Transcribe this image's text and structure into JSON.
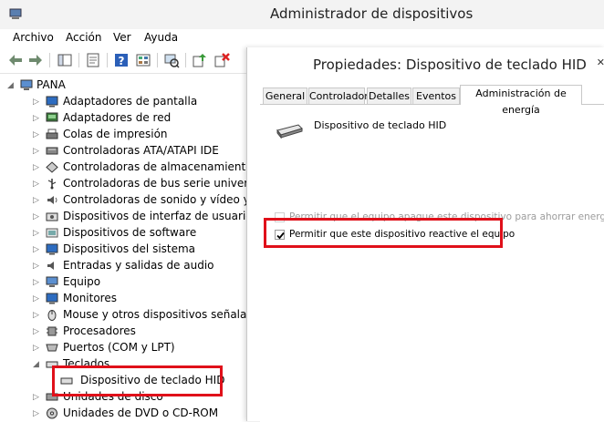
{
  "window": {
    "title": "Administrador de dispositivos"
  },
  "menu": [
    "Archivo",
    "Acción",
    "Ver",
    "Ayuda"
  ],
  "toolbar": {
    "buttons": [
      "back-arrow-icon",
      "forward-arrow-icon",
      "show-hide-tree-icon",
      "properties-icon",
      "help-icon",
      "view-icon",
      "scan-hardware-icon",
      "update-driver-icon",
      "uninstall-device-icon"
    ]
  },
  "tree": {
    "root": "PANA",
    "items": [
      "Adaptadores de pantalla",
      "Adaptadores de red",
      "Colas de impresión",
      "Controladoras ATA/ATAPI IDE",
      "Controladoras de almacenamiento",
      "Controladoras de bus serie universal",
      "Controladoras de sonido y vídeo y disp",
      "Dispositivos de interfaz de usuario (HID",
      "Dispositivos de software",
      "Dispositivos del sistema",
      "Entradas y salidas de audio",
      "Equipo",
      "Monitores",
      "Mouse y otros dispositivos señaladores",
      "Procesadores",
      "Puertos (COM y LPT)",
      "Teclados",
      "Dispositivo de teclado HID",
      "Unidades de disco",
      "Unidades de DVD o CD-ROM"
    ]
  },
  "dialog": {
    "title": "Propiedades: Dispositivo de teclado HID",
    "close": "✕",
    "tabs": [
      "General",
      "Controlador",
      "Detalles",
      "Eventos",
      "Administración de energía"
    ],
    "active_tab": 4,
    "device_name": "Dispositivo de teclado HID",
    "options": [
      {
        "label": "Permitir que el equipo apague este dispositivo para ahorrar energía",
        "checked": false,
        "enabled": false
      },
      {
        "label": "Permitir que este dispositivo reactive el equipo",
        "checked": true,
        "enabled": true
      }
    ]
  },
  "colors": {
    "highlight": "#e0101a"
  }
}
